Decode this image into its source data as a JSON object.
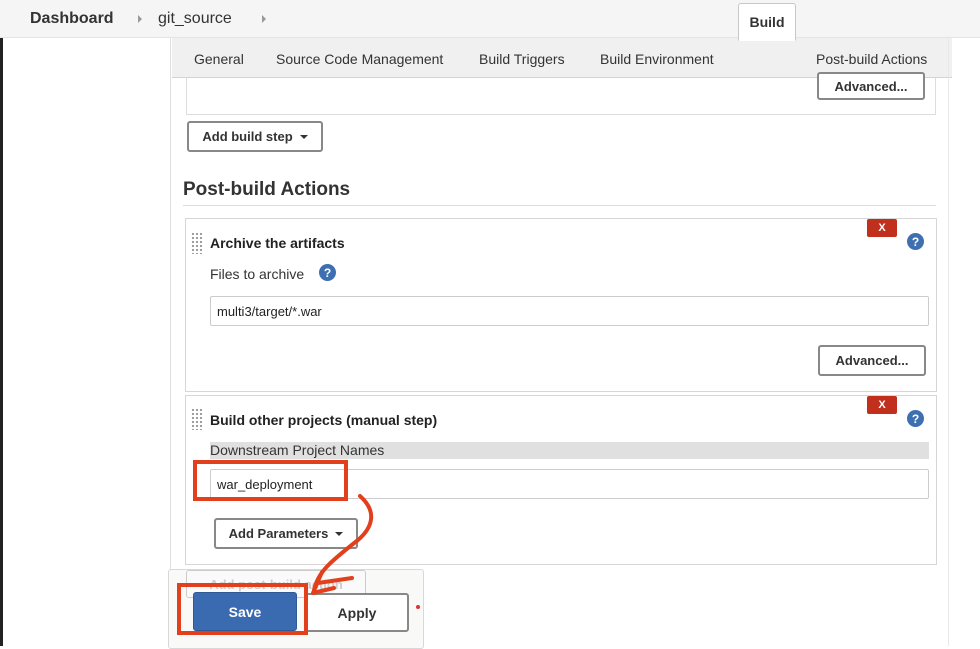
{
  "breadcrumb": {
    "items": [
      "Dashboard",
      "git_source"
    ]
  },
  "tabs": [
    {
      "label": "General",
      "active": false
    },
    {
      "label": "Source Code Management",
      "active": false
    },
    {
      "label": "Build Triggers",
      "active": false
    },
    {
      "label": "Build Environment",
      "active": false
    },
    {
      "label": "Build",
      "active": true
    },
    {
      "label": "Post-build Actions",
      "active": false
    }
  ],
  "build": {
    "advanced_label": "Advanced...",
    "add_build_step_label": "Add build step"
  },
  "post_build": {
    "title": "Post-build Actions",
    "archive": {
      "title": "Archive the artifacts",
      "remove_label": "X",
      "help_label": "?",
      "files_label": "Files to archive",
      "files_value": "multi3/target/*.war",
      "advanced_label": "Advanced..."
    },
    "build_other": {
      "title": "Build other projects (manual step)",
      "remove_label": "X",
      "help_label": "?",
      "downstream_label": "Downstream Project Names",
      "downstream_value": "war_deployment",
      "add_parameters_label": "Add Parameters"
    },
    "add_post_build_label": "Add post-build action"
  },
  "footer": {
    "save_label": "Save",
    "apply_label": "Apply"
  },
  "colors": {
    "primary": "#3a6bb0",
    "danger": "#c0301c",
    "annotation": "#e2401c"
  }
}
